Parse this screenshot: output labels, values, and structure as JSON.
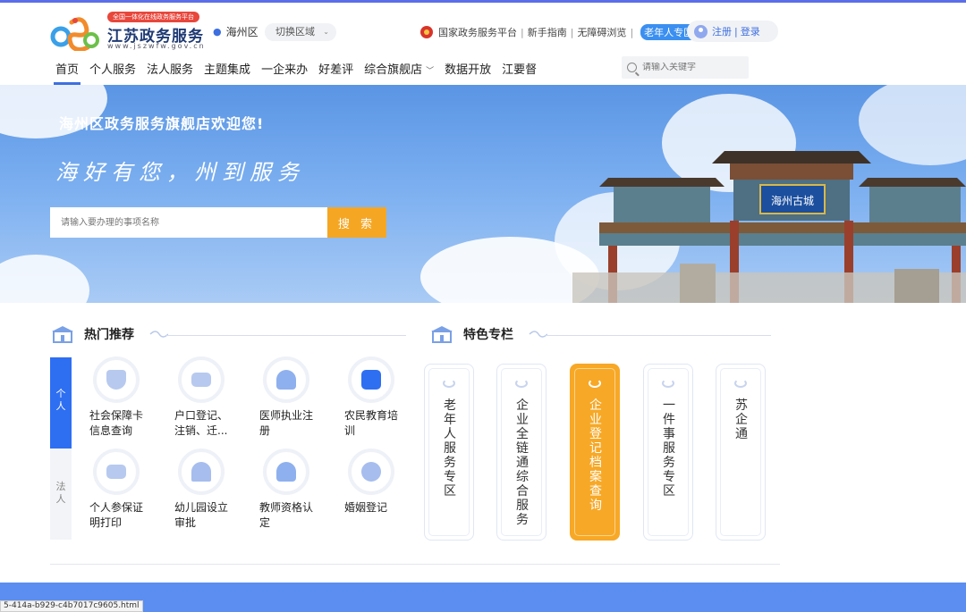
{
  "header": {
    "logo": {
      "badge": "全国一体化在线政务服务平台",
      "title": "江苏政务服务",
      "url": "www.jszwfw.gov.cn"
    },
    "region": "海州区",
    "switch_region": "切换区域",
    "top_links": {
      "national": "国家政务服务平台",
      "guide": "新手指南",
      "accessible": "无障碍浏览",
      "elder": "老年人专区",
      "sep": "|"
    },
    "login": {
      "register": "注册",
      "sep": "|",
      "login": "登录"
    },
    "nav": [
      "首页",
      "个人服务",
      "法人服务",
      "主题集成",
      "一企来办",
      "好差评",
      "综合旗舰店",
      "数据开放",
      "江要督"
    ],
    "search_placeholder": "请输入关键字"
  },
  "banner": {
    "welcome": "海州区政务服务旗舰店欢迎您!",
    "slogan": "海好有您，州到服务",
    "search_placeholder": "请输入要办理的事项名称",
    "search_button": "搜 索",
    "gate_sign": "海州古城"
  },
  "hot": {
    "title": "热门推荐",
    "tabs": [
      [
        "个",
        "人"
      ],
      [
        "法",
        "人"
      ]
    ],
    "services": [
      {
        "lines": [
          "社会保障卡",
          "信息查询"
        ],
        "icon": "shield-icon"
      },
      {
        "lines": [
          "户口登记、",
          "注销、迁..."
        ],
        "icon": "id-card-icon"
      },
      {
        "lines": [
          "医师执业注",
          "册"
        ],
        "icon": "doctor-icon"
      },
      {
        "lines": [
          "农民教育培",
          "训"
        ],
        "icon": "book-icon"
      },
      {
        "lines": [
          "个人参保证",
          "明打印"
        ],
        "icon": "printer-icon"
      },
      {
        "lines": [
          "幼儿园设立",
          "审批"
        ],
        "icon": "school-icon"
      },
      {
        "lines": [
          "教师资格认",
          "定"
        ],
        "icon": "teacher-icon"
      },
      {
        "lines": [
          "婚姻登记",
          ""
        ],
        "icon": "couple-icon"
      }
    ]
  },
  "featured": {
    "title": "特色专栏",
    "items": [
      "老年人服务专区",
      "企业全链通综合服务",
      "企业登记档案查询",
      "一件事服务专区",
      "苏企通"
    ]
  },
  "status_url": "5-414a-b929-c4b7017c9605.html",
  "colors": {
    "primary": "#2e6ff2",
    "accent": "#f7a826",
    "banner": "#6aa2ec"
  }
}
